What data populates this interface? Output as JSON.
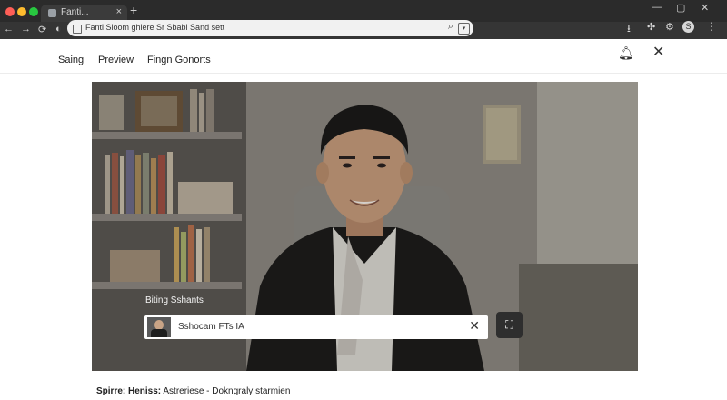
{
  "browser": {
    "tab_title": "Fanti...",
    "tab_close": "×",
    "new_tab": "+",
    "window_controls": [
      "—",
      "▢",
      "✕"
    ],
    "nav_buttons": [
      "←",
      "→",
      "⟳"
    ],
    "address_text": "Fanti Sloom ghiere Sr Sbabl Sand sett",
    "profile_letter": "S",
    "icons": [
      "download-icon",
      "extensions-icon",
      "settings-icon",
      "profile-icon",
      "menu-icon"
    ]
  },
  "header": {
    "nav": [
      "Saing",
      "Preview",
      "Fingn Gonorts"
    ],
    "icons": [
      "bell-icon",
      "close-icon"
    ]
  },
  "video": {
    "overlay_title": "Biting Sshants",
    "overlay_text": "Sshocam FTs IA",
    "overlay_close": "✕",
    "fullscreen_icon": "fullscreen-icon"
  },
  "caption": {
    "label": "Spirre: Heniss:",
    "text": "Astreriese - Dokngraly starmien"
  },
  "colors": {
    "chrome_dark": "#2b2b2b",
    "toolbar": "#353535",
    "video_bg": "#6d6a63"
  }
}
